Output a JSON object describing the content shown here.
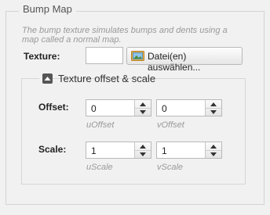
{
  "panel": {
    "title": "Bump Map",
    "description": "The bump texture simulates bumps and dents using a map called a normal map."
  },
  "texture": {
    "label": "Texture:",
    "file_button_label": "Datei(en) auswählen...",
    "file_button_icon": "image-file-icon"
  },
  "offset_scale": {
    "title": "Texture offset & scale",
    "collapse_icon": "minus-collapse-icon",
    "offset": {
      "label": "Offset:",
      "u": {
        "value": "0",
        "caption": "uOffset"
      },
      "v": {
        "value": "0",
        "caption": "vOffset"
      }
    },
    "scale": {
      "label": "Scale:",
      "u": {
        "value": "1",
        "caption": "uScale"
      },
      "v": {
        "value": "1",
        "caption": "vScale"
      }
    }
  }
}
